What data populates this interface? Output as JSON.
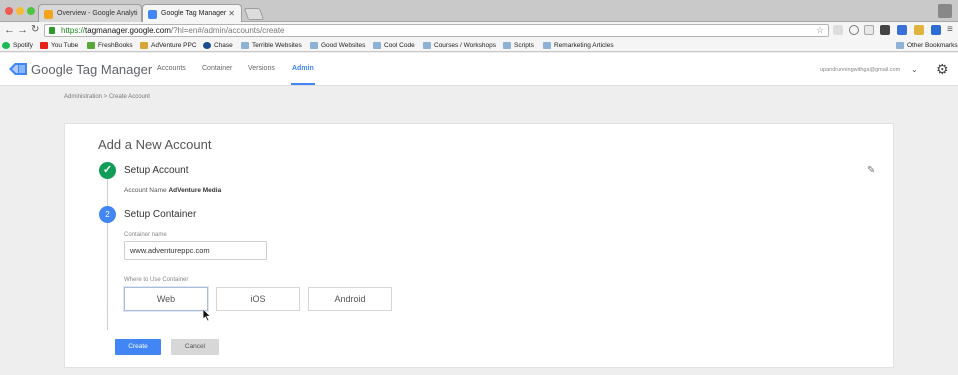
{
  "browser": {
    "tabs": [
      {
        "title": "Overview - Google Analyti",
        "active": false
      },
      {
        "title": "Google Tag Manager",
        "active": true
      }
    ],
    "url": {
      "scheme": "https://",
      "host": "tagmanager.google.com",
      "path": "/?hl=en#/admin/accounts/create"
    },
    "bookmarks": [
      {
        "label": "Spotify",
        "icon": "spotify-icon"
      },
      {
        "label": "You Tube",
        "icon": "youtube-icon"
      },
      {
        "label": "FreshBooks",
        "icon": "freshbooks-icon"
      },
      {
        "label": "AdVenture PPC",
        "icon": "pencil-icon"
      },
      {
        "label": "Chase",
        "icon": "chase-icon"
      },
      {
        "label": "Terrible Websites",
        "icon": "folder-icon"
      },
      {
        "label": "Good Websites",
        "icon": "folder-icon"
      },
      {
        "label": "Cool Code",
        "icon": "folder-icon"
      },
      {
        "label": "Courses / Workshops",
        "icon": "folder-icon"
      },
      {
        "label": "Scripts",
        "icon": "folder-icon"
      },
      {
        "label": "Remarketing Articles",
        "icon": "folder-icon"
      }
    ],
    "other_bookmarks": "Other Bookmarks"
  },
  "app": {
    "brand": "Google Tag Manager",
    "nav": [
      "Accounts",
      "Container",
      "Versions",
      "Admin"
    ],
    "active_nav": "Admin",
    "account_email": "upandrunningwithga@gmail.com"
  },
  "breadcrumb": "Administration > Create Account",
  "form": {
    "title": "Add a New Account",
    "step1": {
      "title": "Setup Account",
      "account_label": "Account Name",
      "account_value": "AdVenture Media"
    },
    "step2": {
      "number": "2",
      "title": "Setup Container"
    },
    "container_name_label": "Container name",
    "container_name_value": "www.adventureppc.com",
    "where_label": "Where to Use Container",
    "choices": [
      "Web",
      "iOS",
      "Android"
    ],
    "selected_choice": "Web",
    "create_label": "Create",
    "cancel_label": "Cancel"
  },
  "colors": {
    "primary": "#4285f4",
    "success": "#0f9d58"
  }
}
